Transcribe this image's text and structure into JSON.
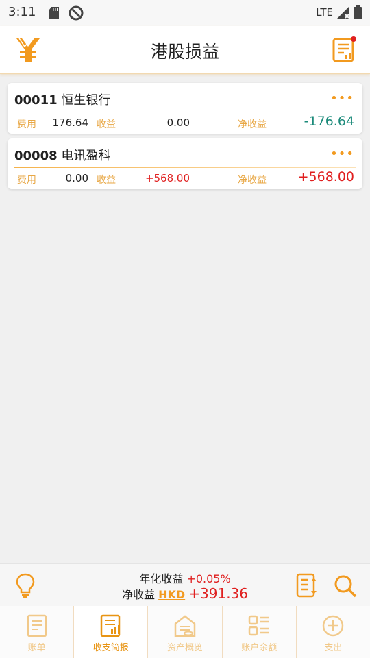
{
  "status": {
    "time": "3:11",
    "network": "LTE"
  },
  "header": {
    "title": "港股损益",
    "left_icon": "yuan-logo-icon",
    "right_icon": "report-notification-icon"
  },
  "labels": {
    "fee": "费用",
    "income": "收益",
    "net": "净收益",
    "more": "•••"
  },
  "cards": [
    {
      "code": "00011",
      "name": "恒生银行",
      "fee": "176.64",
      "income": "0.00",
      "net": "-176.64"
    },
    {
      "code": "00008",
      "name": "电讯盈科",
      "fee": "0.00",
      "income": "+568.00",
      "net": "+568.00"
    }
  ],
  "summary": {
    "annual_label": "年化收益",
    "annual_value": "+0.05%",
    "net_label": "净收益",
    "currency": "HKD",
    "net_value": "+391.36"
  },
  "tabs": [
    {
      "label": "账单",
      "icon": "bill-icon",
      "active": false
    },
    {
      "label": "收支简报",
      "icon": "report-chart-icon",
      "active": true
    },
    {
      "label": "资产概览",
      "icon": "asset-overview-icon",
      "active": false
    },
    {
      "label": "账户余额",
      "icon": "account-balance-icon",
      "active": false
    },
    {
      "label": "支出",
      "icon": "add-circle-icon",
      "active": false
    }
  ],
  "colors": {
    "accent": "#f29a1f",
    "positive": "#e02020",
    "negative": "#1b8a7a"
  }
}
